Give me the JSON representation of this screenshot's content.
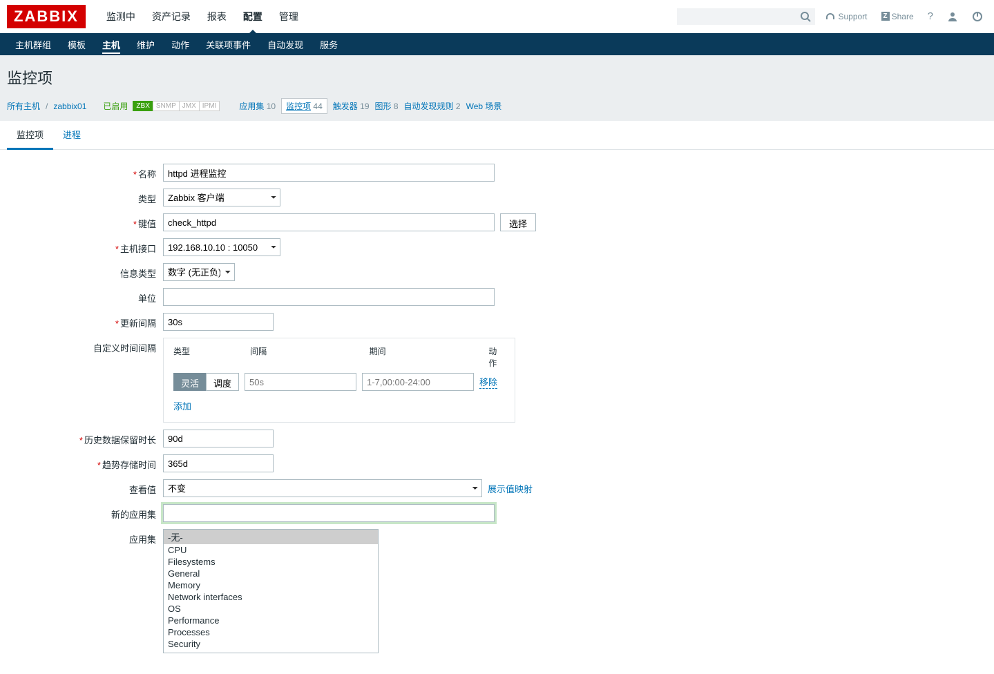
{
  "logo": "ZABBIX",
  "topnav": [
    "监测中",
    "资产记录",
    "报表",
    "配置",
    "管理"
  ],
  "topnav_active": 3,
  "support": "Support",
  "share": "Share",
  "subnav": [
    "主机群组",
    "模板",
    "主机",
    "维护",
    "动作",
    "关联项事件",
    "自动发现",
    "服务"
  ],
  "subnav_active": 2,
  "page_title": "监控项",
  "crumbs": {
    "all_hosts": "所有主机",
    "host": "zabbix01",
    "enabled": "已启用",
    "badges": [
      "ZBX",
      "SNMP",
      "JMX",
      "IPMI"
    ],
    "links": [
      {
        "t": "应用集",
        "n": "10"
      },
      {
        "t": "监控项",
        "n": "44",
        "cur": true
      },
      {
        "t": "触发器",
        "n": "19"
      },
      {
        "t": "图形",
        "n": "8"
      },
      {
        "t": "自动发现规则",
        "n": "2"
      },
      {
        "t": "Web 场景",
        "n": ""
      }
    ]
  },
  "tabs": [
    "监控项",
    "进程"
  ],
  "tabs_active": 0,
  "form": {
    "name_lbl": "名称",
    "name_val": "httpd 进程监控",
    "type_lbl": "类型",
    "type_val": "Zabbix 客户端",
    "key_lbl": "键值",
    "key_val": "check_httpd",
    "key_btn": "选择",
    "iface_lbl": "主机接口",
    "iface_val": "192.168.10.10 : 10050",
    "info_lbl": "信息类型",
    "info_val": "数字 (无正负)",
    "unit_lbl": "单位",
    "unit_val": "",
    "upd_lbl": "更新间隔",
    "upd_val": "30s",
    "cust_lbl": "自定义时间间隔",
    "cust_hdr": [
      "类型",
      "间隔",
      "期间",
      "动作"
    ],
    "cust_flex": "灵活",
    "cust_sched": "调度",
    "cust_int_ph": "50s",
    "cust_per_ph": "1-7,00:00-24:00",
    "cust_remove": "移除",
    "cust_add": "添加",
    "hist_lbl": "历史数据保留时长",
    "hist_val": "90d",
    "trend_lbl": "趋势存储时间",
    "trend_val": "365d",
    "view_lbl": "查看值",
    "view_val": "不变",
    "view_link": "展示值映射",
    "newapp_lbl": "新的应用集",
    "newapp_val": "",
    "apps_lbl": "应用集",
    "apps": [
      "-无-",
      "CPU",
      "Filesystems",
      "General",
      "Memory",
      "Network interfaces",
      "OS",
      "Performance",
      "Processes",
      "Security"
    ]
  }
}
